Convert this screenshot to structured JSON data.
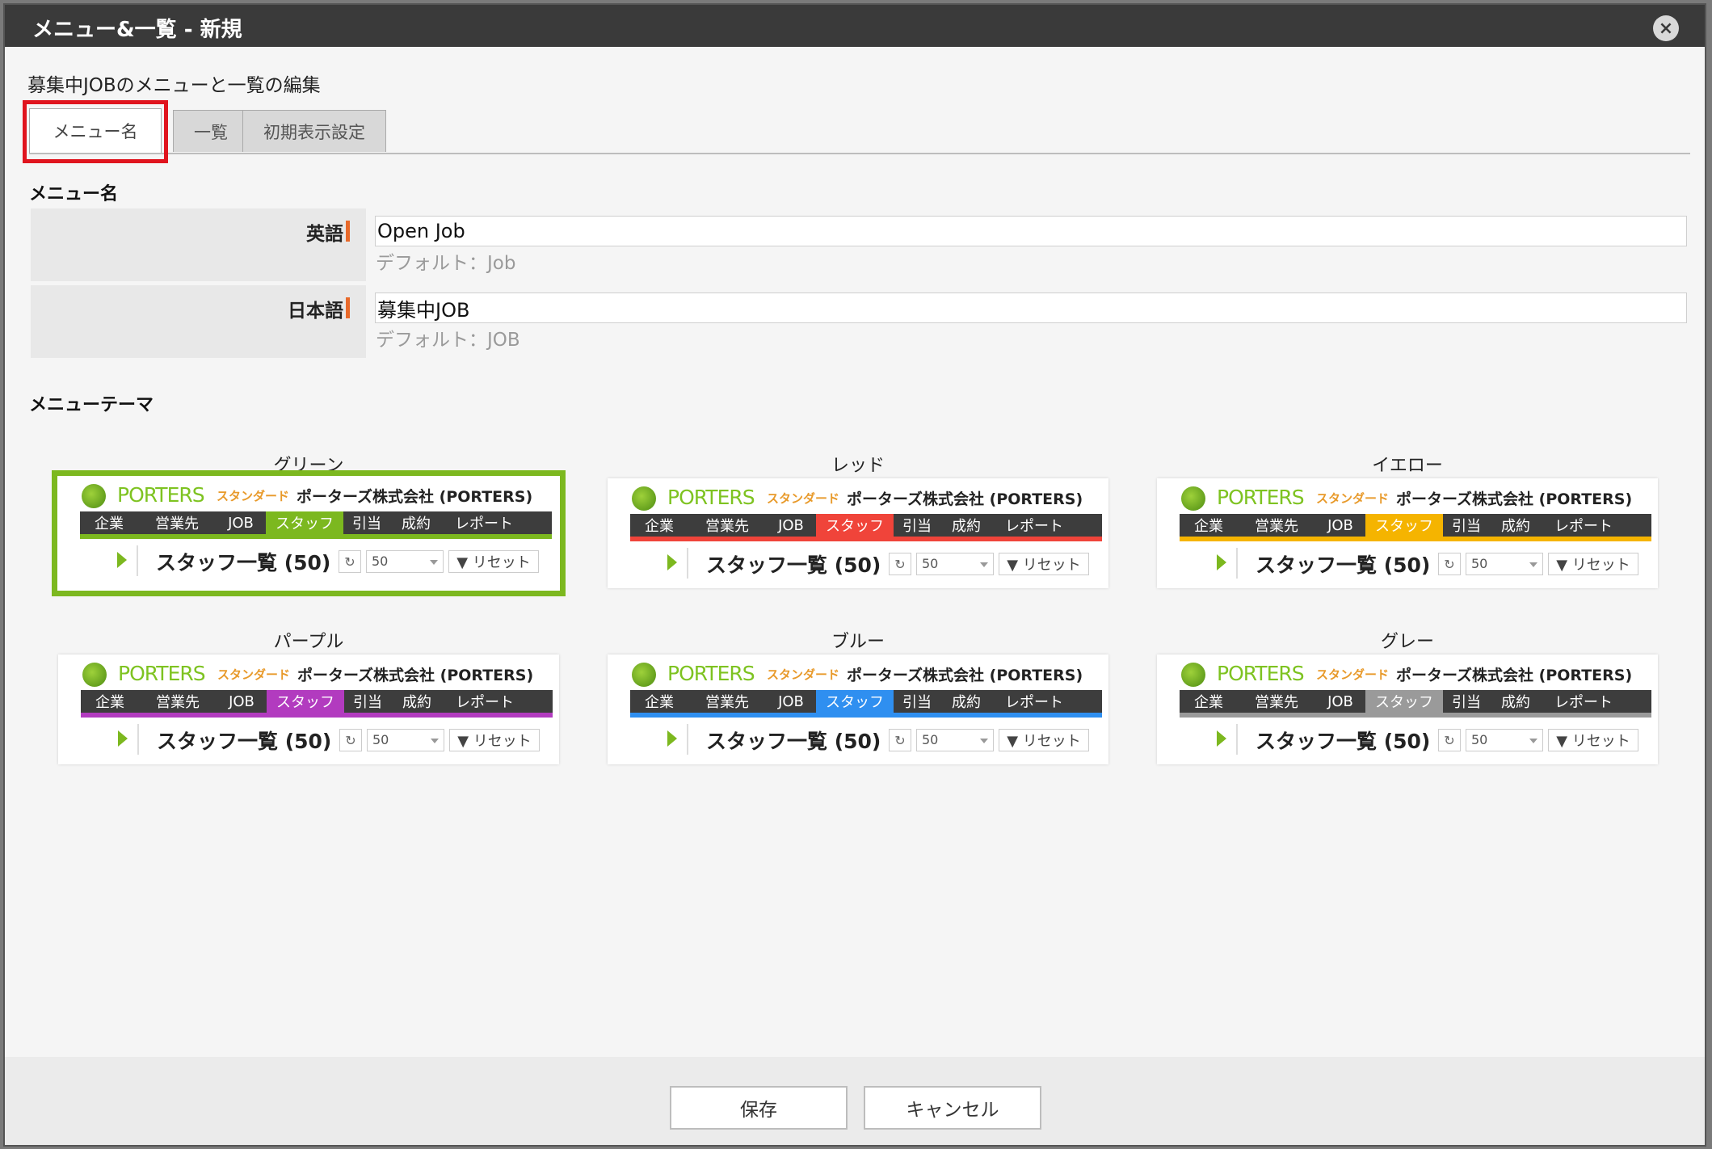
{
  "dialog": {
    "title": "メニュー&一覧 - 新規",
    "close_icon": "×",
    "subtitle": "募集中JOBのメニューと一覧の編集"
  },
  "tabs": [
    {
      "label": "メニュー名",
      "active": true
    },
    {
      "label": "一覧",
      "active": false
    },
    {
      "label": "初期表示設定",
      "active": false
    }
  ],
  "menu_name_section": {
    "title": "メニュー名",
    "english": {
      "label": "英語",
      "value": "Open Job",
      "hint": "デフォルト：Job"
    },
    "japanese": {
      "label": "日本語",
      "value": "募集中JOB",
      "hint": "デフォルト：JOB"
    }
  },
  "theme_section": {
    "title": "メニューテーマ",
    "preview_text": {
      "brand": "PORTERS",
      "edition": "スタンダード",
      "company": "ポーターズ株式会社 (PORTERS)",
      "nav": [
        "企業",
        "営業先",
        "JOB",
        "スタッフ",
        "引当",
        "成約",
        "レポート"
      ],
      "list_title": "スタッフ一覧 (50)",
      "refresh_icon": "↻",
      "page_size": "50",
      "reset": "▼ リセット"
    },
    "themes": [
      {
        "name": "グリーン",
        "color": "#7cb81f",
        "selected": true
      },
      {
        "name": "レッド",
        "color": "#f0443a",
        "selected": false
      },
      {
        "name": "イエロー",
        "color": "#f5b400",
        "selected": false
      },
      {
        "name": "パープル",
        "color": "#b23bbf",
        "selected": false
      },
      {
        "name": "ブルー",
        "color": "#2f8ff0",
        "selected": false
      },
      {
        "name": "グレー",
        "color": "#9a9a9a",
        "selected": false
      }
    ]
  },
  "footer": {
    "save_label": "保存",
    "cancel_label": "キャンセル"
  }
}
